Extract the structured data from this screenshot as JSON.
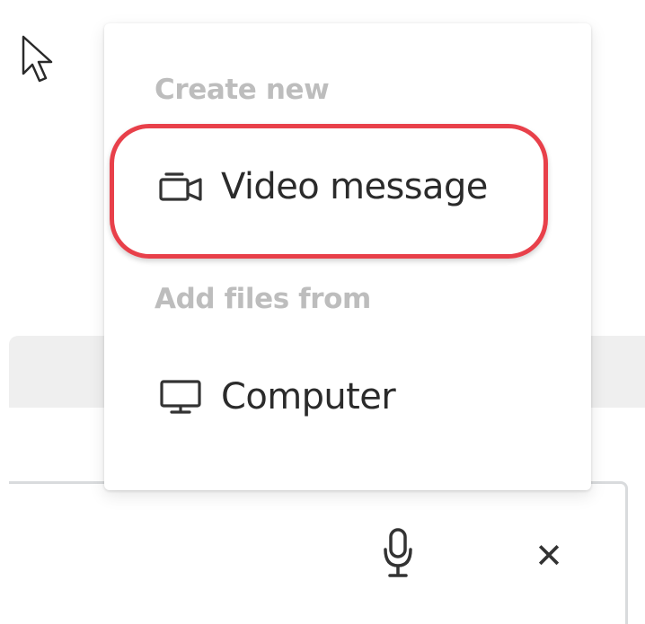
{
  "menu": {
    "sections": [
      {
        "header": "Create new",
        "items": [
          {
            "label": "Video message",
            "icon": "video-camera-icon"
          }
        ]
      },
      {
        "header": "Add files from",
        "items": [
          {
            "label": "Computer",
            "icon": "monitor-icon"
          }
        ]
      }
    ],
    "highlighted_item": "Video message"
  },
  "compose": {
    "mic_icon": "microphone-icon",
    "close_icon": "close-icon",
    "close_glyph": "✕"
  },
  "colors": {
    "highlight_ring": "#e8404a",
    "section_header": "#bdbdbd",
    "item_text": "#2b2b2b"
  }
}
